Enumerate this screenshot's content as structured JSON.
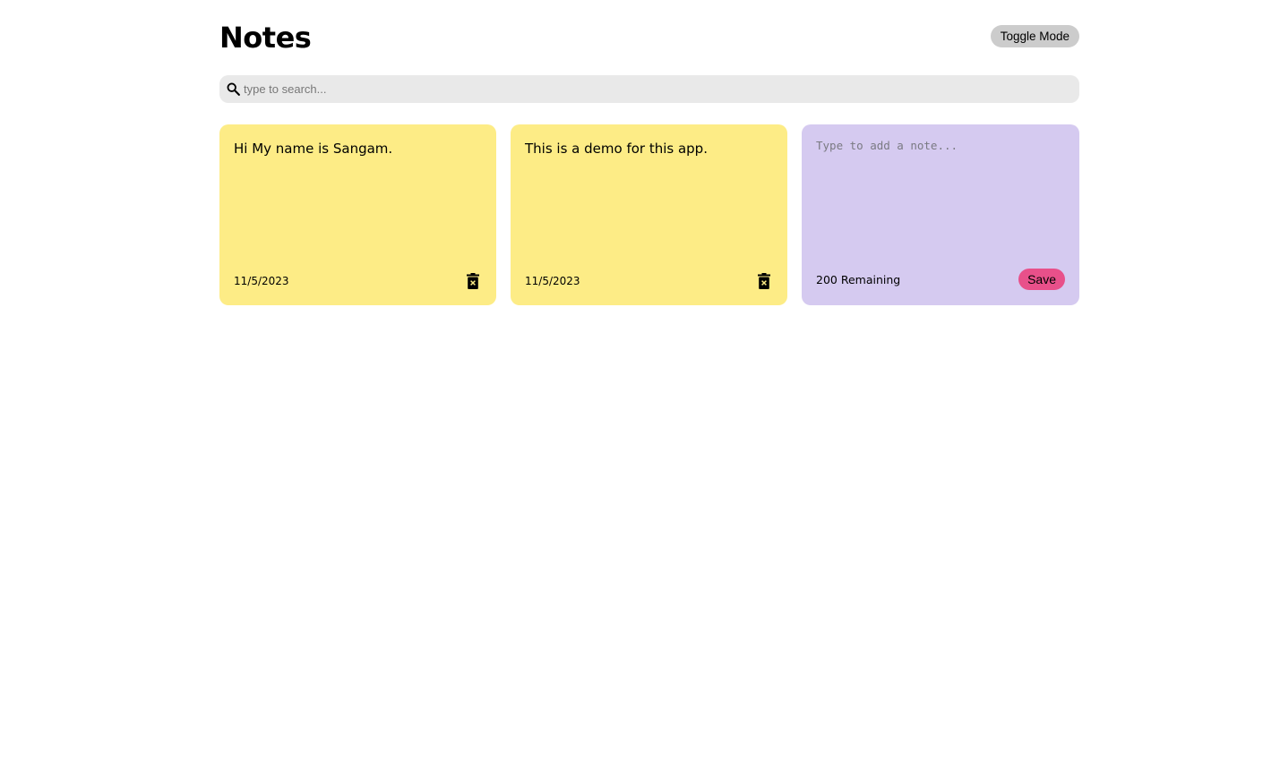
{
  "header": {
    "title": "Notes",
    "toggle_label": "Toggle Mode"
  },
  "search": {
    "placeholder": "type to search...",
    "value": "",
    "icon": "search-icon"
  },
  "notes": [
    {
      "text": "Hi My name is Sangam.",
      "date": "11/5/2023",
      "delete_icon": "trash-icon"
    },
    {
      "text": "This is a demo for this app.",
      "date": "11/5/2023",
      "delete_icon": "trash-icon"
    }
  ],
  "add_note": {
    "placeholder": "Type to add a note...",
    "value": "",
    "remaining": "200 Remaining",
    "save_label": "Save"
  },
  "colors": {
    "note_bg": "#fdec86",
    "new_note_bg": "#d5caf0",
    "save_button": "#e8508a",
    "toggle_button": "#cccccc",
    "search_bg": "#e9e9e9"
  }
}
